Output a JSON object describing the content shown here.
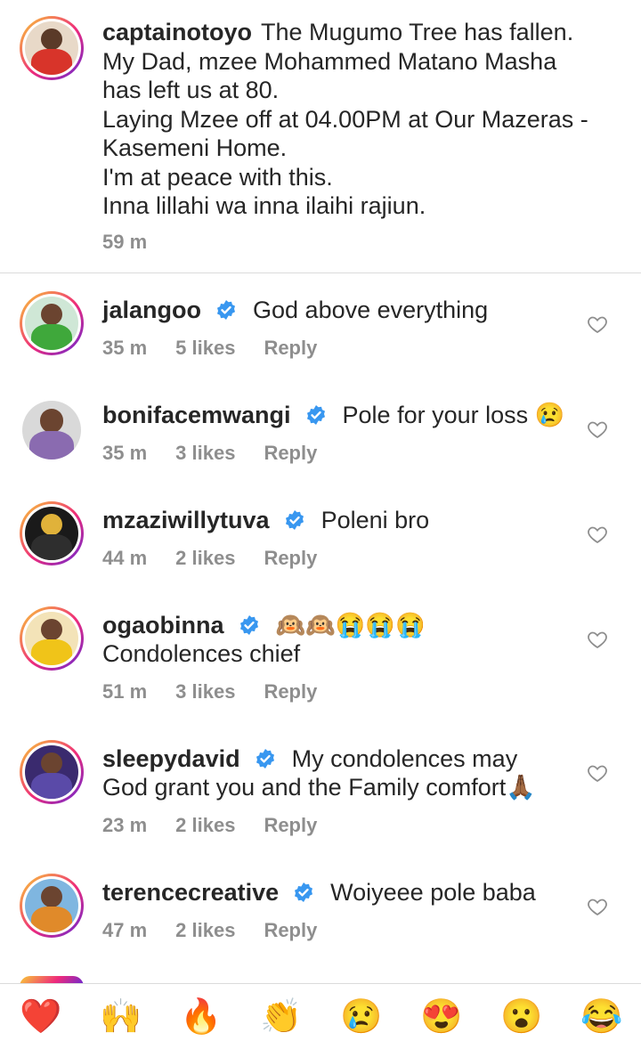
{
  "caption": {
    "username": "captainotoyo",
    "lines": [
      "The Mugumo Tree has fallen.",
      "My Dad, mzee Mohammed Matano Masha",
      "has left us at 80.",
      "Laying Mzee off at 04.00PM at Our Mazeras -",
      "Kasemeni Home.",
      "I'm at peace with this.",
      "Inna lillahi wa inna ilaihi rajiun."
    ],
    "time": "59 m"
  },
  "comments": [
    {
      "username": "jalangoo",
      "text": "God above everything",
      "time": "35 m",
      "likes": "5 likes",
      "reply": "Reply"
    },
    {
      "username": "bonifacemwangi",
      "text": "Pole for your loss 😢",
      "time": "35 m",
      "likes": "3 likes",
      "reply": "Reply"
    },
    {
      "username": "mzaziwillytuva",
      "text": "Poleni bro",
      "time": "44 m",
      "likes": "2 likes",
      "reply": "Reply"
    },
    {
      "username": "ogaobinna",
      "text": "🙉🙉😭😭😭 Condolences chief",
      "time": "51 m",
      "likes": "3 likes",
      "reply": "Reply"
    },
    {
      "username": "sleepydavid",
      "text": "My condolences may God grant you and the Family comfort🙏🏾",
      "time": "23 m",
      "likes": "2 likes",
      "reply": "Reply"
    },
    {
      "username": "terencecreative",
      "text": "Woiyeee pole baba",
      "time": "47 m",
      "likes": "2 likes",
      "reply": "Reply"
    }
  ],
  "reactions": [
    "❤️",
    "🙌",
    "🔥",
    "👏",
    "😢",
    "😍",
    "😮",
    "😂"
  ],
  "colors": {
    "verified": "#3897f0",
    "meta": "#8e8e8e",
    "text": "#262626"
  }
}
